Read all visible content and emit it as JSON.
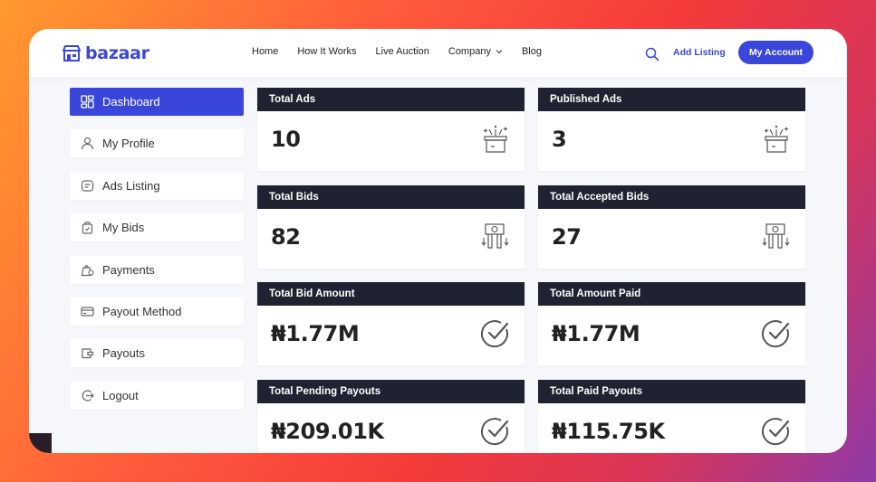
{
  "brand": {
    "name": "bazaar"
  },
  "nav": [
    {
      "label": "Home"
    },
    {
      "label": "How It Works"
    },
    {
      "label": "Live Auction"
    },
    {
      "label": "Company",
      "has_dropdown": true
    },
    {
      "label": "Blog"
    }
  ],
  "header": {
    "add_listing_label": "Add Listing",
    "account_label": "My Account"
  },
  "sidebar": {
    "items": [
      {
        "label": "Dashboard",
        "icon": "dashboard-icon",
        "active": true
      },
      {
        "label": "My Profile",
        "icon": "user-icon"
      },
      {
        "label": "Ads Listing",
        "icon": "ads-icon"
      },
      {
        "label": "My Bids",
        "icon": "bag-icon"
      },
      {
        "label": "Payments",
        "icon": "payment-icon"
      },
      {
        "label": "Payout Method",
        "icon": "card-icon"
      },
      {
        "label": "Payouts",
        "icon": "wallet-icon"
      },
      {
        "label": "Logout",
        "icon": "logout-icon"
      }
    ]
  },
  "stats": [
    {
      "title": "Total Ads",
      "value": "10",
      "icon": "gift-box-icon"
    },
    {
      "title": "Published Ads",
      "value": "3",
      "icon": "gift-box-icon"
    },
    {
      "title": "Total Bids",
      "value": "82",
      "icon": "bid-money-icon"
    },
    {
      "title": "Total Accepted Bids",
      "value": "27",
      "icon": "bid-money-icon"
    },
    {
      "title": "Total Bid Amount",
      "value": "₦1.77M",
      "icon": "check-circle-icon"
    },
    {
      "title": "Total Amount Paid",
      "value": "₦1.77M",
      "icon": "check-circle-icon"
    },
    {
      "title": "Total Pending Payouts",
      "value": "₦209.01K",
      "icon": "check-circle-icon"
    },
    {
      "title": "Total Paid Payouts",
      "value": "₦115.75K",
      "icon": "check-circle-icon"
    }
  ],
  "colors": {
    "accent": "#3a46d9",
    "card_header": "#1f2230"
  }
}
